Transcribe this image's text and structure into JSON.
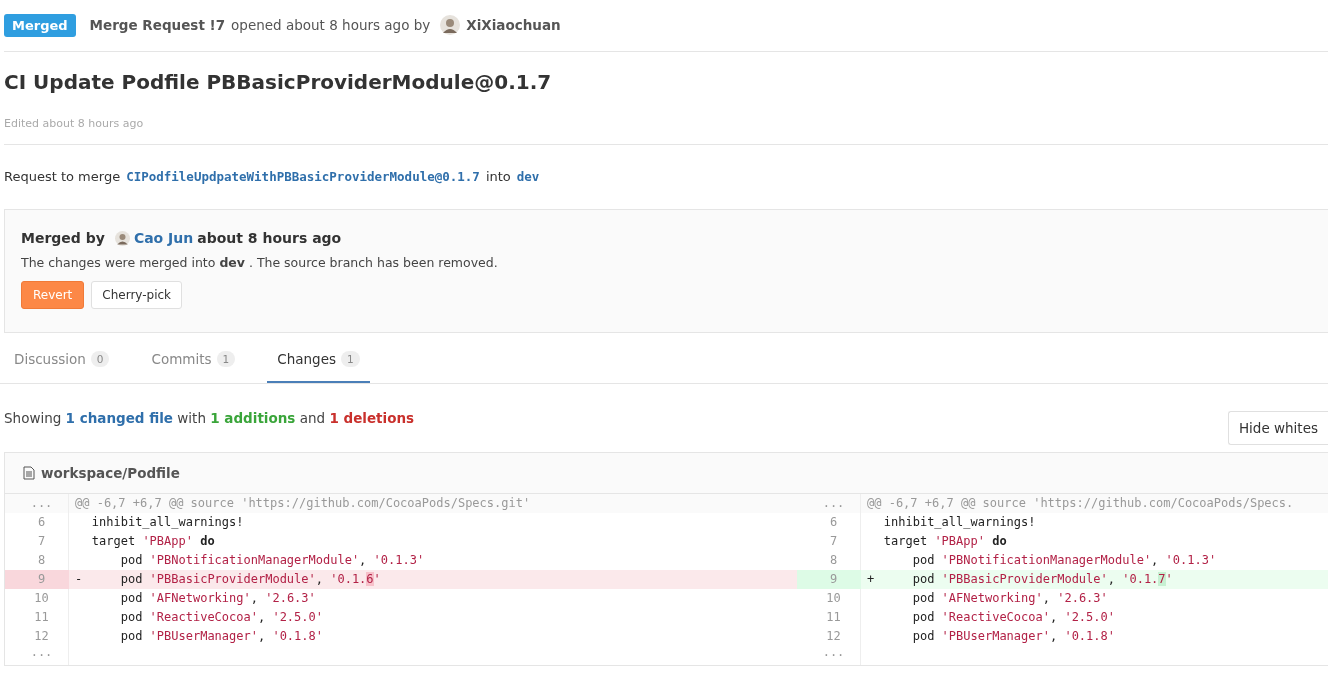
{
  "header": {
    "status": "Merged",
    "reference": "Merge Request !7",
    "opened": "opened about 8 hours ago by",
    "author": "XiXiaochuan"
  },
  "title": "CI Update Podfile PBBasicProviderModule@0.1.7",
  "edited": "Edited about 8 hours ago",
  "request": {
    "prefix": "Request to merge",
    "source": "CIPodfileUpdpateWithPBBasicProviderModule@0.1.7",
    "middle": "into",
    "target": "dev"
  },
  "merge_widget": {
    "label": "Merged by",
    "user": "Cao Jun",
    "time": "about 8 hours ago",
    "message": "The changes were merged into **dev** . The source branch has been removed.",
    "buttons": [
      {
        "label": "Revert",
        "kind": "primary"
      },
      {
        "label": "Cherry-pick",
        "kind": "default"
      }
    ]
  },
  "tabs": [
    {
      "label": "Discussion",
      "count": "0",
      "selected": false
    },
    {
      "label": "Commits",
      "count": "1",
      "selected": false
    },
    {
      "label": "Changes",
      "count": "1",
      "selected": true
    }
  ],
  "summary": [
    {
      "kind": "plain",
      "text": "Showing "
    },
    {
      "kind": "files",
      "text": "1 changed file"
    },
    {
      "kind": "plain",
      "text": " with "
    },
    {
      "kind": "additions",
      "text": "1 additions"
    },
    {
      "kind": "plain",
      "text": " and "
    },
    {
      "kind": "deletions",
      "text": "1 deletions"
    }
  ],
  "hide_whitespace_button": "Hide whites",
  "file": {
    "path": "workspace/Podfile",
    "left": [
      {
        "number": "...",
        "kind": "hunk",
        "text": "@@ -6,7 +6,7 @@ source 'https://github.com/CocoaPods/Specs.git'"
      },
      {
        "number": "6",
        "kind": "context",
        "tokens": [
          {
            "kind": "plain",
            "text": "inhibit_all_warnings!"
          }
        ]
      },
      {
        "number": "7",
        "kind": "context",
        "tokens": [
          {
            "kind": "plain",
            "text": "target "
          },
          {
            "kind": "string",
            "text": "'PBApp'"
          },
          {
            "kind": "keyword",
            "text": " do"
          }
        ]
      },
      {
        "number": "8",
        "kind": "context",
        "tokens": [
          {
            "kind": "plain",
            "text": "    pod "
          },
          {
            "kind": "string",
            "text": "'PBNotificationManagerModule'"
          },
          {
            "kind": "plain",
            "text": ", "
          },
          {
            "kind": "string",
            "text": "'0.1.3'"
          }
        ]
      },
      {
        "number": "9",
        "kind": "removed",
        "marker": "-",
        "tokens": [
          {
            "kind": "plain",
            "text": "    pod "
          },
          {
            "kind": "string",
            "text": "'PBBasicProviderModule'"
          },
          {
            "kind": "plain",
            "text": ", "
          },
          {
            "kind": "string",
            "text": "'0.1."
          },
          {
            "kind": "changed",
            "text": "6"
          },
          {
            "kind": "string",
            "text": "'"
          }
        ]
      },
      {
        "number": "10",
        "kind": "context",
        "tokens": [
          {
            "kind": "plain",
            "text": "    pod "
          },
          {
            "kind": "string",
            "text": "'AFNetworking'"
          },
          {
            "kind": "plain",
            "text": ", "
          },
          {
            "kind": "string",
            "text": "'2.6.3'"
          }
        ]
      },
      {
        "number": "11",
        "kind": "context",
        "tokens": [
          {
            "kind": "plain",
            "text": "    pod "
          },
          {
            "kind": "string",
            "text": "'ReactiveCocoa'"
          },
          {
            "kind": "plain",
            "text": ", "
          },
          {
            "kind": "string",
            "text": "'2.5.0'"
          }
        ]
      },
      {
        "number": "12",
        "kind": "context",
        "tokens": [
          {
            "kind": "plain",
            "text": "    pod "
          },
          {
            "kind": "string",
            "text": "'PBUserManager'"
          },
          {
            "kind": "plain",
            "text": ", "
          },
          {
            "kind": "string",
            "text": "'0.1.8'"
          }
        ]
      },
      {
        "number": "...",
        "kind": "expander"
      }
    ],
    "right": [
      {
        "number": "...",
        "kind": "hunk",
        "text": "@@ -6,7 +6,7 @@ source 'https://github.com/CocoaPods/Specs."
      },
      {
        "number": "6",
        "kind": "context",
        "tokens": [
          {
            "kind": "plain",
            "text": "inhibit_all_warnings!"
          }
        ]
      },
      {
        "number": "7",
        "kind": "context",
        "tokens": [
          {
            "kind": "plain",
            "text": "target "
          },
          {
            "kind": "string",
            "text": "'PBApp'"
          },
          {
            "kind": "keyword",
            "text": " do"
          }
        ]
      },
      {
        "number": "8",
        "kind": "context",
        "tokens": [
          {
            "kind": "plain",
            "text": "    pod "
          },
          {
            "kind": "string",
            "text": "'PBNotificationManagerModule'"
          },
          {
            "kind": "plain",
            "text": ", "
          },
          {
            "kind": "string",
            "text": "'0.1.3'"
          }
        ]
      },
      {
        "number": "9",
        "kind": "added",
        "marker": "+",
        "tokens": [
          {
            "kind": "plain",
            "text": "    pod "
          },
          {
            "kind": "string",
            "text": "'PBBasicProviderModule'"
          },
          {
            "kind": "plain",
            "text": ", "
          },
          {
            "kind": "string",
            "text": "'0.1."
          },
          {
            "kind": "changed",
            "text": "7"
          },
          {
            "kind": "string",
            "text": "'"
          }
        ]
      },
      {
        "number": "10",
        "kind": "context",
        "tokens": [
          {
            "kind": "plain",
            "text": "    pod "
          },
          {
            "kind": "string",
            "text": "'AFNetworking'"
          },
          {
            "kind": "plain",
            "text": ", "
          },
          {
            "kind": "string",
            "text": "'2.6.3'"
          }
        ]
      },
      {
        "number": "11",
        "kind": "context",
        "tokens": [
          {
            "kind": "plain",
            "text": "    pod "
          },
          {
            "kind": "string",
            "text": "'ReactiveCocoa'"
          },
          {
            "kind": "plain",
            "text": ", "
          },
          {
            "kind": "string",
            "text": "'2.5.0'"
          }
        ]
      },
      {
        "number": "12",
        "kind": "context",
        "tokens": [
          {
            "kind": "plain",
            "text": "    pod "
          },
          {
            "kind": "string",
            "text": "'PBUserManager'"
          },
          {
            "kind": "plain",
            "text": ", "
          },
          {
            "kind": "string",
            "text": "'0.1.8'"
          }
        ]
      },
      {
        "number": "...",
        "kind": "expander"
      }
    ]
  }
}
